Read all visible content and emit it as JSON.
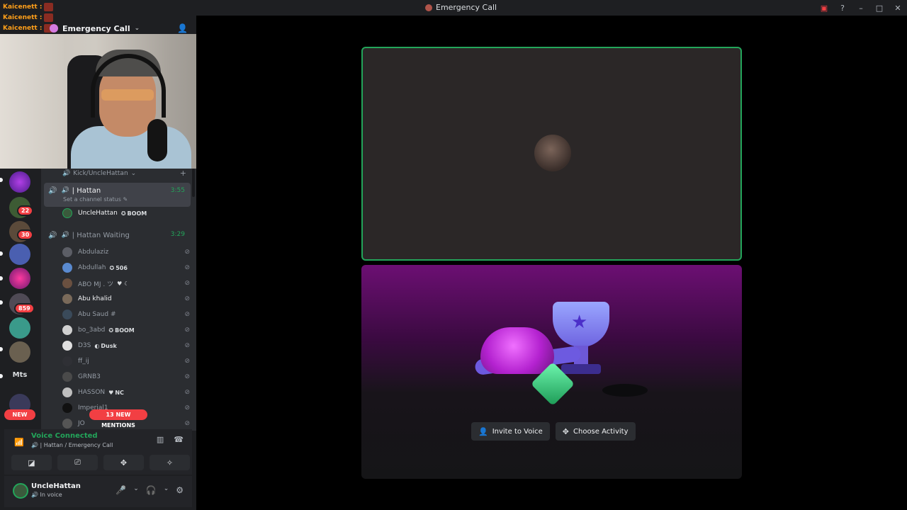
{
  "window": {
    "title": "Emergency Call"
  },
  "chat": [
    {
      "name": "Kaicenett :"
    },
    {
      "name": "Kaicenett :"
    },
    {
      "name": "Kaicenett :"
    }
  ],
  "server": {
    "name": "Emergency Call"
  },
  "guilds": {
    "badges": [
      "22",
      "30",
      "859"
    ],
    "text_guild": "Mts",
    "new_label": "NEW"
  },
  "channels": {
    "category": "Kick/UncleHattan",
    "voice_channels": [
      {
        "name": "| Hattan",
        "time": "3:55",
        "status": "Set a channel status"
      },
      {
        "name": "| Hattan Waiting",
        "time": "3:29"
      }
    ],
    "hattan_members": [
      {
        "name": "UncleHattan",
        "tag": "BOOM"
      }
    ],
    "waiting_members": [
      {
        "name": "Abdulaziz",
        "tag": ""
      },
      {
        "name": "Abdullah",
        "tag": "506"
      },
      {
        "name": "ABO MJ . ツ",
        "tag": ""
      },
      {
        "name": "Abu khalid",
        "tag": ""
      },
      {
        "name": "Abu Saud #",
        "tag": ""
      },
      {
        "name": "bo_3abd",
        "tag": "BOOM"
      },
      {
        "name": "D3S",
        "tag": "Dusk"
      },
      {
        "name": "ff_ij",
        "tag": ""
      },
      {
        "name": "GRNB3",
        "tag": ""
      },
      {
        "name": "HASSON",
        "tag": "NC"
      },
      {
        "name": "Imperial1",
        "tag": ""
      },
      {
        "name": "JO",
        "tag": ""
      }
    ],
    "mentions_label": "13 NEW MENTIONS"
  },
  "voice": {
    "title": "Voice Connected",
    "subtitle": "| Hattan / Emergency Call"
  },
  "user": {
    "name": "UncleHattan",
    "status": "In voice"
  },
  "stage": {
    "invite_label": "Invite to Voice",
    "activity_label": "Choose Activity"
  },
  "colors": {
    "accent_green": "#23a55a",
    "badge_red": "#f23f43",
    "background": "#1e1f22"
  },
  "icons": [
    "search-icon",
    "speaker-icon",
    "deafen-icon",
    "headphones-icon",
    "gear-icon",
    "microphone-icon",
    "hangup-icon"
  ]
}
